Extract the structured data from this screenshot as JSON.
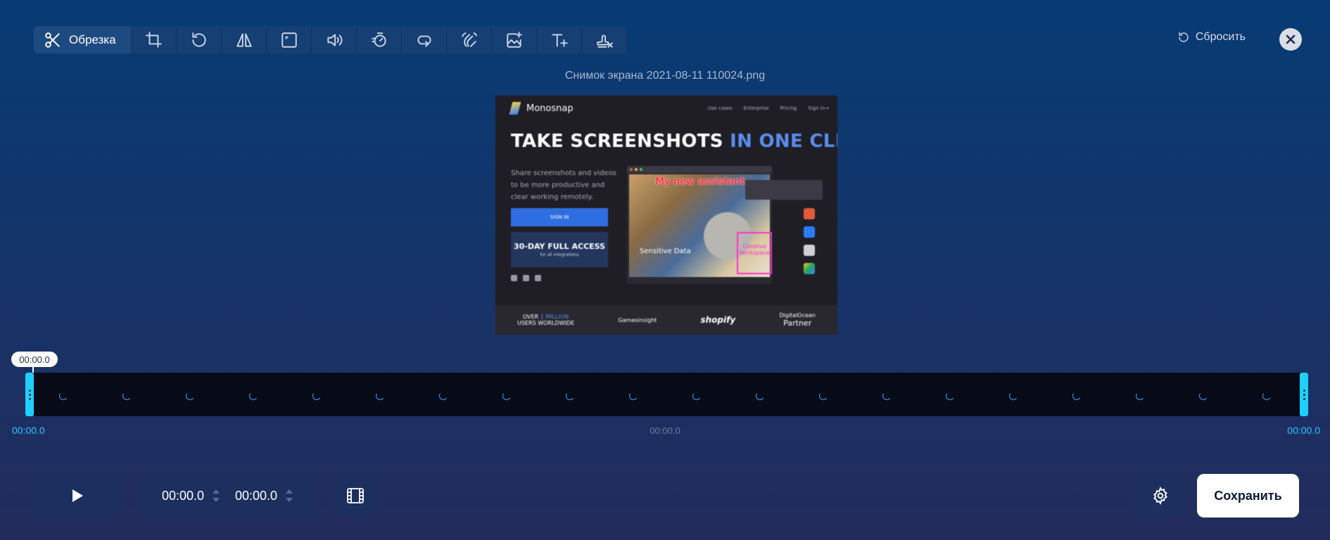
{
  "toolbar": {
    "active_tool_label": "Обрезка",
    "tools": [
      "scissors-icon",
      "crop-icon",
      "rotate-icon",
      "flip-icon",
      "resize-icon",
      "volume-icon",
      "speed-icon",
      "loop-icon",
      "wave-icon",
      "add-image-icon",
      "add-text-icon",
      "remove-watermark-icon"
    ]
  },
  "header": {
    "reset_label": "Сбросить"
  },
  "file": {
    "name": "Снимок экрана 2021-08-11 110024.png"
  },
  "preview": {
    "brand": "Monosnap",
    "nav_links": [
      "Use cases",
      "Enterprise",
      "Pricing",
      "Sign in→"
    ],
    "headline_part1": "TAKE SCREENSHOTS",
    "headline_part2": "IN ONE CLICK",
    "subtitle": "Share screenshots and videos to be more productive and clear working remotely.",
    "signin_label": "SIGN IN",
    "access_title": "30-DAY FULL ACCESS",
    "access_sub": "for all integrations",
    "annotation_assistant": "My new assistant",
    "annotation_sensitive": "Sensitive Data",
    "annotation_creative": "Creative Workspace",
    "footer_over": "OVER",
    "footer_million": "1 MILLION",
    "footer_users": "USERS WORLDWIDE",
    "footer_logo1": "Gamesinsight",
    "footer_logo2": "shopify",
    "footer_logo3": "DigitalOcean",
    "footer_logo3_sub": "Partner"
  },
  "timeline": {
    "marker_time": "00:00.0",
    "start_time": "00:00.0",
    "mid_time": "00:00.0",
    "end_time": "00:00.0"
  },
  "controls": {
    "start_value": "00:00.0",
    "end_value": "00:00.0",
    "save_label": "Сохранить"
  },
  "colors": {
    "accent": "#1fd0ff",
    "background_top": "#073b74",
    "background_bottom": "#232b5c"
  }
}
